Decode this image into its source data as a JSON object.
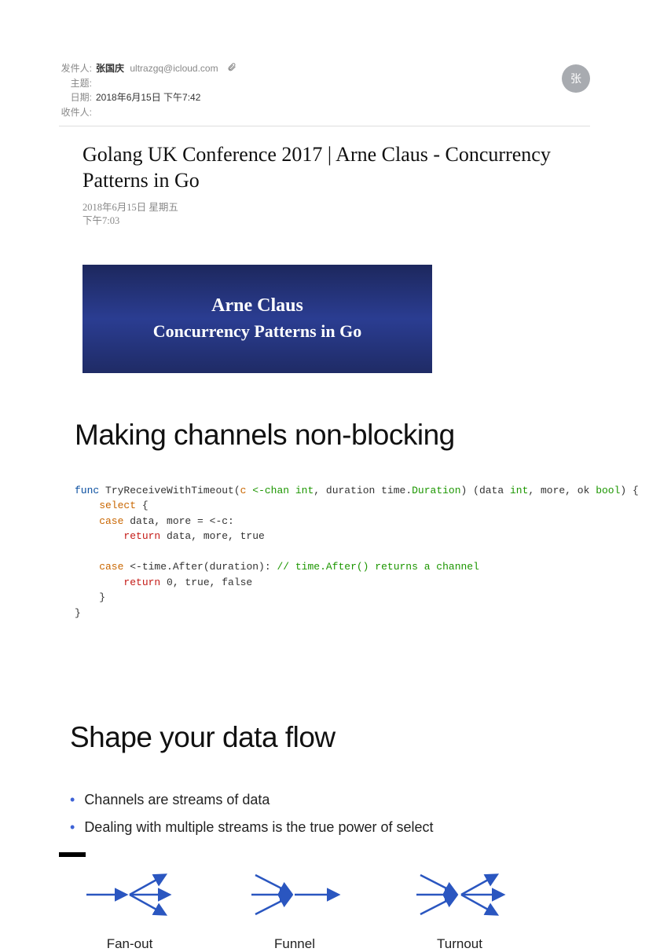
{
  "header": {
    "labels": {
      "from": "发件人:",
      "subject": "主题:",
      "date": "日期:",
      "to": "收件人:"
    },
    "from_name": "张国庆",
    "from_email": "ultrazgq@icloud.com",
    "subject": "",
    "date": "2018年6月15日 下午7:42",
    "to": "",
    "avatar_char": "张"
  },
  "body": {
    "title": "Golang UK Conference 2017 | Arne Claus - Concurrency Patterns in Go",
    "meta_line1": "2018年6月15日 星期五",
    "meta_line2": "下午7:03"
  },
  "slide1": {
    "line1": "Arne Claus",
    "line2": "Concurrency Patterns in Go"
  },
  "section1": {
    "title": "Making channels non-blocking",
    "code": {
      "t1": "func",
      "t2": " TryReceiveWithTimeout(",
      "t3": "c",
      "t4": " <-chan",
      "t5": " int",
      "t6": ", duration time.",
      "t7": "Duration",
      "t8": ") (data ",
      "t9": "int",
      "t10": ", more, ok ",
      "t11": "bool",
      "t12": ") {",
      "l2a": "    select",
      "l2b": " {",
      "l3a": "    case",
      "l3b": " data, more = <-c:",
      "l4a": "        return",
      "l4b": " data, more, true",
      "blank": "",
      "l5a": "    case",
      "l5b": " <-time.After(duration): ",
      "l5c": "// time.After() returns a channel",
      "l6a": "        return",
      "l6b": " 0, true, false",
      "l7": "    }",
      "l8": "}"
    }
  },
  "section2": {
    "title": "Shape your data flow",
    "bullet1": "Channels are streams of data",
    "bullet2": "Dealing with multiple streams is the true power of select",
    "diagram1": "Fan-out",
    "diagram2": "Funnel",
    "diagram3": "Turnout"
  }
}
